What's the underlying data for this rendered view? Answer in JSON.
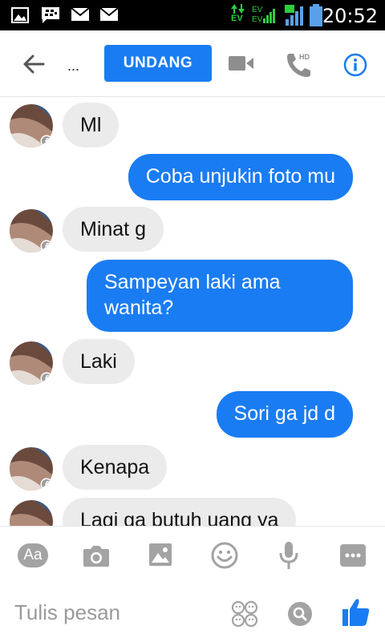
{
  "status_bar": {
    "time": "20:52",
    "network_1": "EV",
    "network_2": "EV",
    "network_3": "EV"
  },
  "header": {
    "title": "...",
    "invite_label": "UNDANG",
    "hd_label": "HD"
  },
  "messages": [
    {
      "direction": "in",
      "text": "Ml"
    },
    {
      "direction": "out",
      "text": "Coba unjukin foto mu"
    },
    {
      "direction": "in",
      "text": "Minat g"
    },
    {
      "direction": "out",
      "text": "Sampeyan laki ama wanita?"
    },
    {
      "direction": "in",
      "text": "Laki"
    },
    {
      "direction": "out",
      "text": "Sori ga jd d"
    },
    {
      "direction": "in",
      "text": "Kenapa"
    },
    {
      "direction": "in",
      "text": "Lagi ga butuh uang ya"
    }
  ],
  "composer": {
    "aa_label": "Aa",
    "placeholder": "Tulis pesan"
  },
  "colors": {
    "accent": "#1a7cf2",
    "incoming_bubble": "#ebebeb",
    "icon_gray": "#8e8e8e"
  }
}
